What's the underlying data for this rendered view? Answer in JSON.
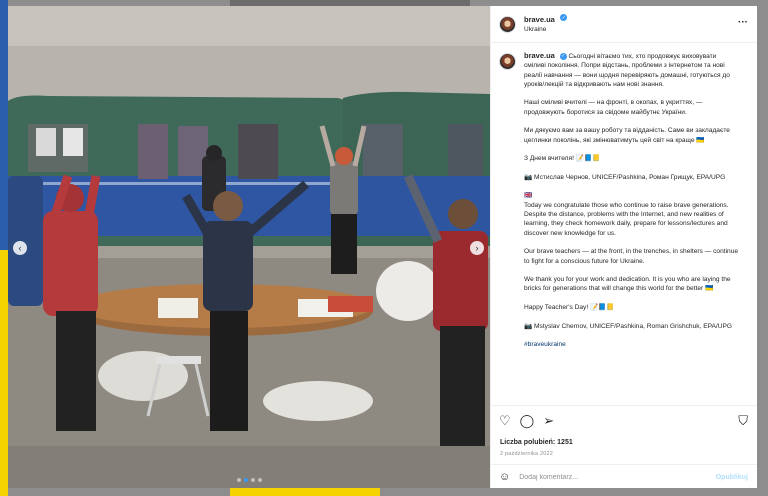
{
  "post": {
    "username": "brave.ua",
    "location": "Ukraine",
    "more_icon": "more-horizontal-icon",
    "caption": [
      "Сьогодні вітаємо тих, хто продовжує виховувати сміливі покоління. Попри відстань, проблеми з інтернетом та нові реалії навчання — вони щодня перевіряють домашні, готуються до уроків/лекцій та відкривають нам нові знання.",
      "Наші сміливі вчителі — на фронті, в окопах, в укриттях, — продовжують боротися за свідоме майбутнє України.",
      "Ми дякуємо вам за вашу роботу та відданість. Саме ви закладаєте цеглинки поколінь, які змінюватимуть цей світ на краще 🇺🇦",
      "З Днем вчителя! 📝📘📒",
      "📷 Мстислав Чернов, UNICEF/Pashkina, Роман Грищук, EPA/UPG",
      "🇬🇧\nToday we congratulate those who continue to raise brave generations. Despite the distance, problems with the Internet, and new realities of learning, they check homework daily, prepare for lessons/lectures and discover new knowledge for us.",
      "Our brave teachers — at the front, in the trenches, in shelters — continue to fight for a conscious future for Ukraine.",
      "We thank you for your work and dedication. It is you who are laying the bricks for generations that will change this world for the better 🇺🇦",
      "Happy Teacher's Day! 📝📘📒",
      "📷 Mstyslav Chernov, UNICEF/Pashkina, Roman Grishchuk, EPA/UPG"
    ],
    "hashtag": "#braveukraine",
    "likes": "Liczba polubień: 1251",
    "date": "2 października 2022",
    "comment_placeholder": "Dodaj komentarz...",
    "post_label": "Opublikuj",
    "photo_alt": "Children in a metro station raising their arms with a teacher"
  },
  "carousel": {
    "slides": 4,
    "active": 1
  },
  "colors": {
    "accent": "#3897f0",
    "link": "#00376b",
    "muted": "#8e8e8e",
    "post_disabled": "#b2dffc"
  },
  "icons": {
    "like": "heart-icon",
    "comment": "comment-icon",
    "share": "send-icon",
    "save": "bookmark-icon",
    "emoji": "emoji-icon"
  }
}
